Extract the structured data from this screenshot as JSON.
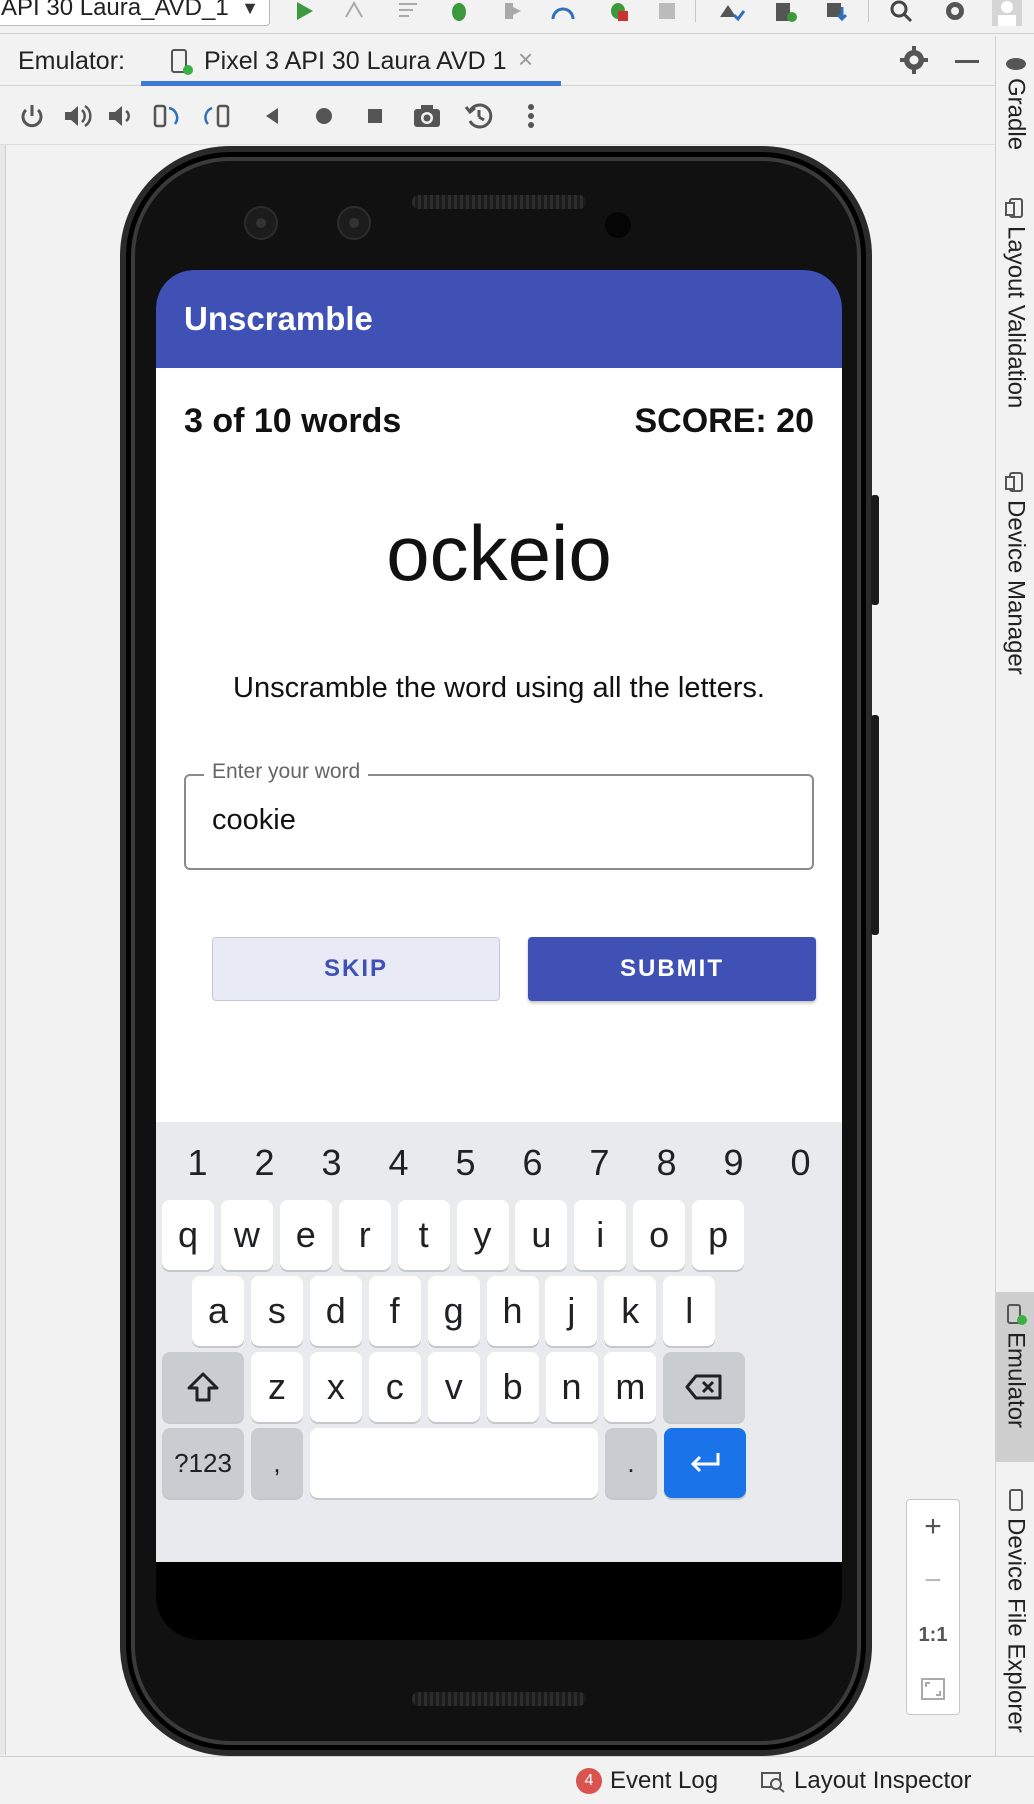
{
  "toolbar": {
    "run_config": "API 30 Laura_AVD_1"
  },
  "emulator_panel": {
    "label": "Emulator:",
    "tab_title": "Pixel 3 API 30 Laura AVD 1"
  },
  "right_tools": [
    {
      "label": "Gradle"
    },
    {
      "label": "Layout Validation"
    },
    {
      "label": "Device Manager"
    },
    {
      "label": "Emulator"
    },
    {
      "label": "Device File Explorer"
    }
  ],
  "app": {
    "title": "Unscramble",
    "word_count": "3 of 10 words",
    "score": "SCORE: 20",
    "scrambled_word": "ockeio",
    "instructions": "Unscramble the word using all the letters.",
    "input_label": "Enter your word",
    "input_value": "cookie",
    "skip_label": "SKIP",
    "submit_label": "SUBMIT",
    "theme_color": "#3f51b5"
  },
  "keyboard": {
    "numbers": [
      "1",
      "2",
      "3",
      "4",
      "5",
      "6",
      "7",
      "8",
      "9",
      "0"
    ],
    "row1": [
      "q",
      "w",
      "e",
      "r",
      "t",
      "y",
      "u",
      "i",
      "o",
      "p"
    ],
    "row2": [
      "a",
      "s",
      "d",
      "f",
      "g",
      "h",
      "j",
      "k",
      "l"
    ],
    "row3": [
      "z",
      "x",
      "c",
      "v",
      "b",
      "n",
      "m"
    ],
    "symbols_key": "?123",
    "comma_key": ",",
    "period_key": "."
  },
  "zoom": {
    "plus": "+",
    "minus": "−",
    "one_to_one": "1:1"
  },
  "statusbar": {
    "event_log_count": "4",
    "event_log_label": "Event Log",
    "layout_inspector_label": "Layout Inspector"
  }
}
